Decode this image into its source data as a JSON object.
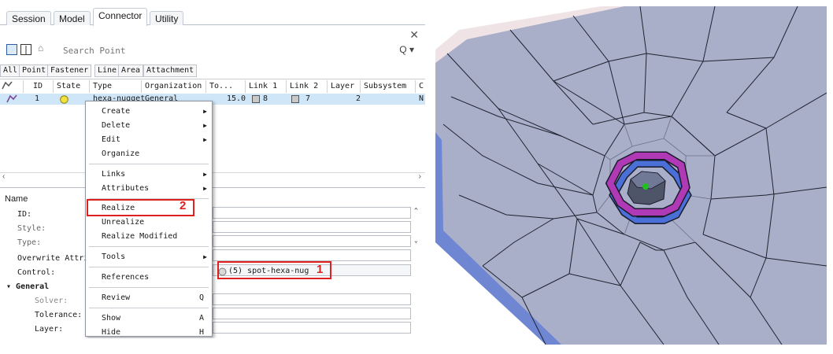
{
  "tabs": [
    "Session",
    "Model",
    "Connector",
    "Utility"
  ],
  "active_tab": "Connector",
  "search": {
    "placeholder": "Search Point"
  },
  "filters": [
    "All",
    "Point",
    "Fastener",
    "Line",
    "Area",
    "Attachment"
  ],
  "table": {
    "headers": [
      "ID",
      "State",
      "Type",
      "Organization",
      "To...",
      "Link 1",
      "Link 2",
      "Layer",
      "Subsystem",
      "C"
    ],
    "rows": [
      {
        "id": "1",
        "type": "hexa-nugget",
        "organization": "General",
        "tolerance": "15.0",
        "link1": "8",
        "link2": "7",
        "layer": "2",
        "c": "N"
      }
    ]
  },
  "properties": {
    "header": "Name",
    "fields": [
      "ID:",
      "Style:",
      "Type:",
      "Overwrite Attri",
      "Control:"
    ],
    "section": "General",
    "section_fields": [
      "Solver:",
      "Tolerance:",
      "Layer:"
    ],
    "control_value": "(5) spot-hexa-nug"
  },
  "context_menu": {
    "items": [
      {
        "label": "Create",
        "submenu": true
      },
      {
        "label": "Delete",
        "submenu": true
      },
      {
        "label": "Edit",
        "submenu": true
      },
      {
        "label": "Organize",
        "submenu": false
      },
      {
        "label": "Links",
        "submenu": true
      },
      {
        "label": "Attributes",
        "submenu": true
      },
      {
        "label": "Realize",
        "submenu": false
      },
      {
        "label": "Unrealize",
        "submenu": false
      },
      {
        "label": "Realize Modified",
        "submenu": false
      },
      {
        "label": "Tools",
        "submenu": true
      },
      {
        "label": "References",
        "submenu": false
      },
      {
        "label": "Review",
        "key": "Q"
      },
      {
        "label": "Show",
        "key": "A"
      },
      {
        "label": "Hide",
        "key": "H"
      }
    ]
  },
  "annotations": {
    "one": "1",
    "two": "2"
  },
  "colors": {
    "selection": "#cfe6f8",
    "annotation": "#e02020",
    "mesh": "#a9aec9",
    "ring_top": "#b03ab5",
    "ring_bottom": "#4a6fd6",
    "node": "#20c020"
  },
  "icons": {
    "close": "close-icon",
    "search": "search-icon",
    "state": "yellow-circle-icon"
  }
}
